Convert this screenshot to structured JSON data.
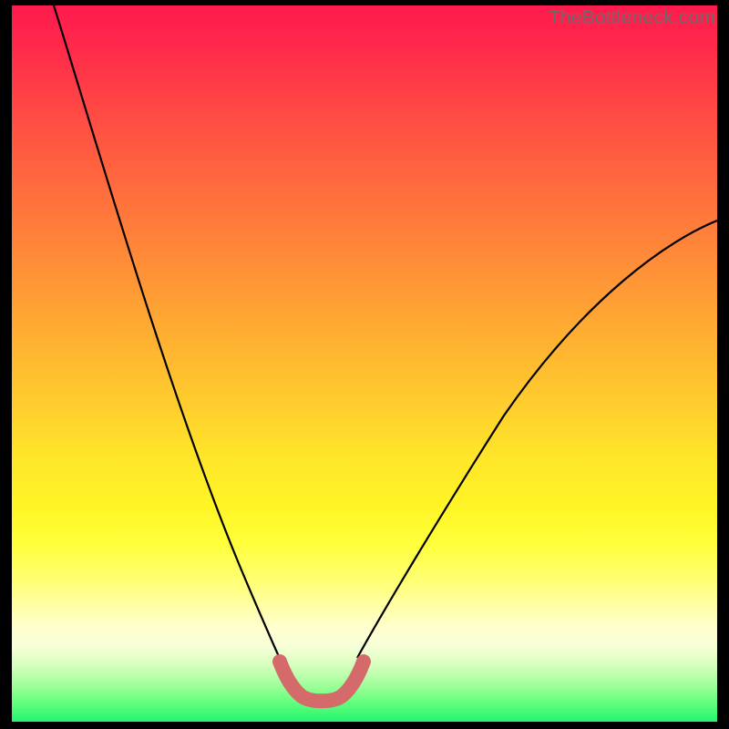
{
  "watermark": "TheBottleneck.com",
  "chart_data": {
    "type": "line",
    "title": "",
    "xlabel": "",
    "ylabel": "",
    "xlim": [
      0,
      100
    ],
    "ylim": [
      0,
      100
    ],
    "grid": false,
    "legend": false,
    "background": {
      "style": "vertical-gradient",
      "stops": [
        {
          "pos": 0,
          "color": "#ff1a4d"
        },
        {
          "pos": 50,
          "color": "#ffc030"
        },
        {
          "pos": 75,
          "color": "#ffff3a"
        },
        {
          "pos": 90,
          "color": "#f0ffcf"
        },
        {
          "pos": 100,
          "color": "#23f56e"
        }
      ]
    },
    "series": [
      {
        "name": "left-descending-curve",
        "stroke": "#000000",
        "stroke_width": 2,
        "x": [
          6,
          10,
          14,
          18,
          22,
          26,
          30,
          34,
          36,
          38,
          39
        ],
        "y": [
          100,
          87,
          74,
          61,
          48,
          36,
          25,
          15,
          11,
          8,
          6
        ]
      },
      {
        "name": "valley-segment",
        "stroke": "#d46a6a",
        "stroke_width": 9,
        "x": [
          38,
          39,
          40,
          41,
          42,
          43,
          44,
          45,
          46,
          47,
          48,
          49,
          50
        ],
        "y": [
          8,
          6,
          4.3,
          3.3,
          2.8,
          2.6,
          2.6,
          2.8,
          3.3,
          4.2,
          5.5,
          7.2,
          9
        ]
      },
      {
        "name": "right-ascending-curve",
        "stroke": "#000000",
        "stroke_width": 2,
        "x": [
          49,
          52,
          56,
          60,
          66,
          72,
          78,
          84,
          90,
          96,
          100
        ],
        "y": [
          7,
          11,
          17,
          23,
          31,
          39,
          46,
          53,
          60,
          66,
          70
        ]
      }
    ],
    "annotations": []
  }
}
